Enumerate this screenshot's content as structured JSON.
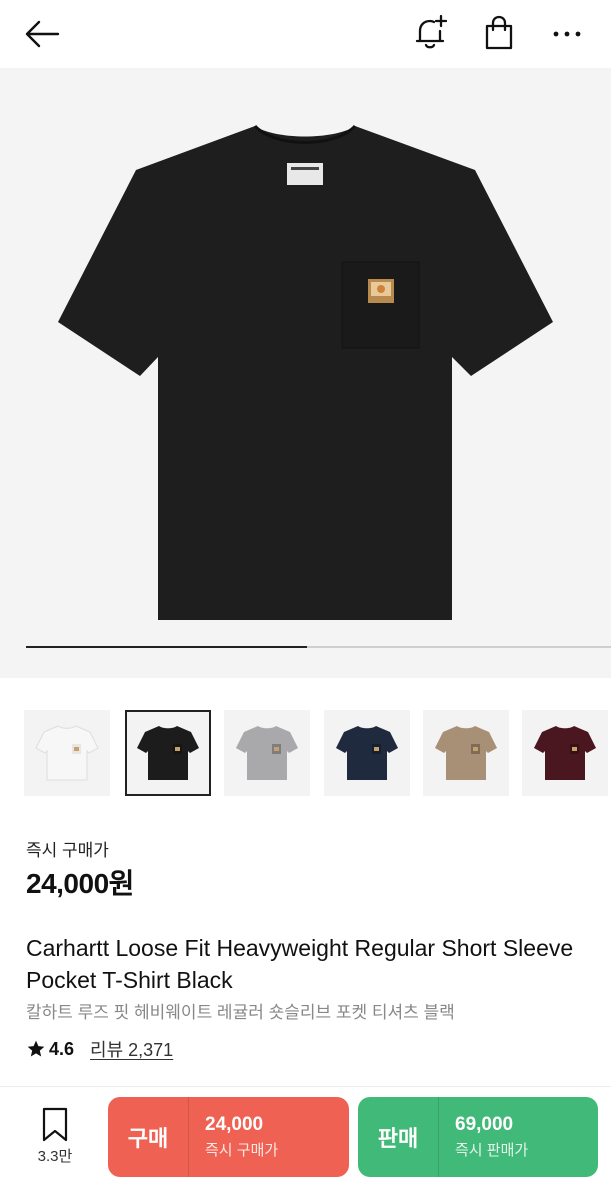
{
  "header": {
    "back_icon": "arrow-left-icon",
    "alert_icon": "bell-plus-icon",
    "cart_icon": "shopping-bag-icon",
    "more_icon": "more-horizontal-icon"
  },
  "hero": {
    "image": "black-pocket-tshirt",
    "garment_color": "#1e1e1e",
    "image_index_progress": 0.48
  },
  "colors": [
    {
      "name": "white",
      "hex": "#f7f7f7",
      "selected": false
    },
    {
      "name": "black",
      "hex": "#1c1c1c",
      "selected": true
    },
    {
      "name": "grey",
      "hex": "#a9a9ab",
      "selected": false
    },
    {
      "name": "navy",
      "hex": "#1f2a3f",
      "selected": false
    },
    {
      "name": "brown",
      "hex": "#a89076",
      "selected": false
    },
    {
      "name": "burgundy",
      "hex": "#4a1620",
      "selected": false
    }
  ],
  "price": {
    "label": "즉시 구매가",
    "value": "24,000원"
  },
  "product": {
    "title_en": "Carhartt Loose Fit Heavyweight Regular Short Sleeve Pocket T-Shirt Black",
    "title_ko": "칼하트 루즈 핏 헤비웨이트 레귤러 숏슬리브 포켓 티셔츠 블랙"
  },
  "rating": {
    "star_icon": "star-icon",
    "score": "4.6",
    "review_text": "리뷰 2,371"
  },
  "bottom": {
    "wish_icon": "bookmark-icon",
    "wish_count": "3.3만",
    "buy": {
      "label": "구매",
      "amount": "24,000",
      "sub": "즉시 구매가",
      "color": "#ef6253"
    },
    "sell": {
      "label": "판매",
      "amount": "69,000",
      "sub": "즉시 판매가",
      "color": "#41b979"
    }
  }
}
